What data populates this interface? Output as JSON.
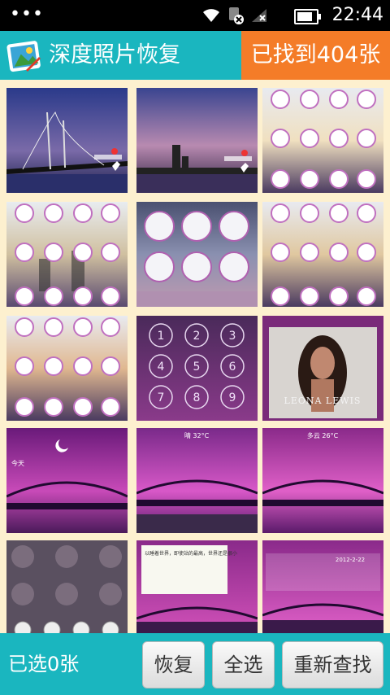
{
  "status_bar": {
    "time": "22:44"
  },
  "header": {
    "title": "深度照片恢复",
    "found_label": "已找到404张"
  },
  "bottom_bar": {
    "selected_label": "已选0张",
    "recover_label": "恢复",
    "select_all_label": "全选",
    "rescan_label": "重新查找"
  },
  "photos": [
    {
      "kind": "bridge-dusk",
      "caption": ""
    },
    {
      "kind": "skyline-dusk",
      "caption": ""
    },
    {
      "kind": "icon-theme",
      "caption": ""
    },
    {
      "kind": "icon-theme",
      "caption": ""
    },
    {
      "kind": "lockscreen-icons",
      "caption": ""
    },
    {
      "kind": "icon-theme",
      "caption": ""
    },
    {
      "kind": "icon-theme",
      "caption": ""
    },
    {
      "kind": "keypad",
      "caption": ""
    },
    {
      "kind": "album-cover",
      "caption": "LEONA LEWIS"
    },
    {
      "kind": "purple-bridge",
      "caption": "今天"
    },
    {
      "kind": "purple-bridge",
      "caption": "晴 32°C"
    },
    {
      "kind": "purple-bridge",
      "caption": "多云 26°C"
    },
    {
      "kind": "dark-blur",
      "caption": ""
    },
    {
      "kind": "note-bridge",
      "caption": "以睡着世界，即使站的最高，世界还是很小"
    },
    {
      "kind": "purple-bridge",
      "caption": "2012-2-22"
    }
  ]
}
